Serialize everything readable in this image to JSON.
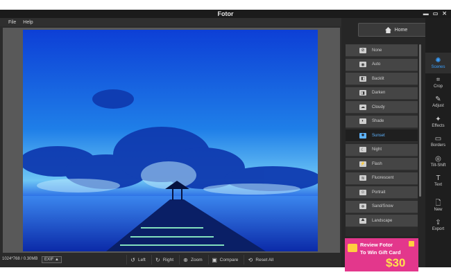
{
  "window": {
    "title": "Fotor"
  },
  "window_controls": {
    "minimize": "▬",
    "maximize": "▭",
    "close": "✕"
  },
  "menu": {
    "file": "File",
    "help": "Help"
  },
  "status": {
    "image_info": "1024*768 / 0.30MB",
    "exif": "EXIF ▲"
  },
  "toolbar": {
    "left": "Left",
    "right": "Right",
    "zoom": "Zoom",
    "compare": "Compare",
    "reset_all": "Reset All"
  },
  "home": {
    "label": "Home"
  },
  "scenes": [
    {
      "label": "None",
      "icon": "⊘"
    },
    {
      "label": "Auto",
      "icon": "◉"
    },
    {
      "label": "Backlit",
      "icon": "◧"
    },
    {
      "label": "Darken",
      "icon": "◨"
    },
    {
      "label": "Cloudy",
      "icon": "☁"
    },
    {
      "label": "Shade",
      "icon": "◐"
    },
    {
      "label": "Sunset",
      "icon": "✺",
      "active": true
    },
    {
      "label": "Night",
      "icon": "☾"
    },
    {
      "label": "Flash",
      "icon": "⚡"
    },
    {
      "label": "Fluorescent",
      "icon": "≋"
    },
    {
      "label": "Portrait",
      "icon": "☺"
    },
    {
      "label": "Sand/Snow",
      "icon": "❄"
    },
    {
      "label": "Landscape",
      "icon": "⛰"
    }
  ],
  "ad": {
    "line1": "Review Fotor",
    "line2": "To Win Gift Card",
    "amount": "$30"
  },
  "nav": [
    {
      "label": "Scenes",
      "icon": "✺",
      "active": true
    },
    {
      "label": "Crop",
      "icon": "⌗"
    },
    {
      "label": "Adjust",
      "icon": "✎"
    },
    {
      "label": "Effects",
      "icon": "✦"
    },
    {
      "label": "Borders",
      "icon": "▭"
    },
    {
      "label": "Tilt-Shift",
      "icon": "◎"
    },
    {
      "label": "Text",
      "icon": "T"
    },
    {
      "label": "New",
      "icon": "🗋"
    },
    {
      "label": "Export",
      "icon": "⇪"
    }
  ],
  "colors": {
    "accent": "#3aa0ff",
    "ad_pink": "#e3378c",
    "ad_yellow": "#ffe04d"
  }
}
